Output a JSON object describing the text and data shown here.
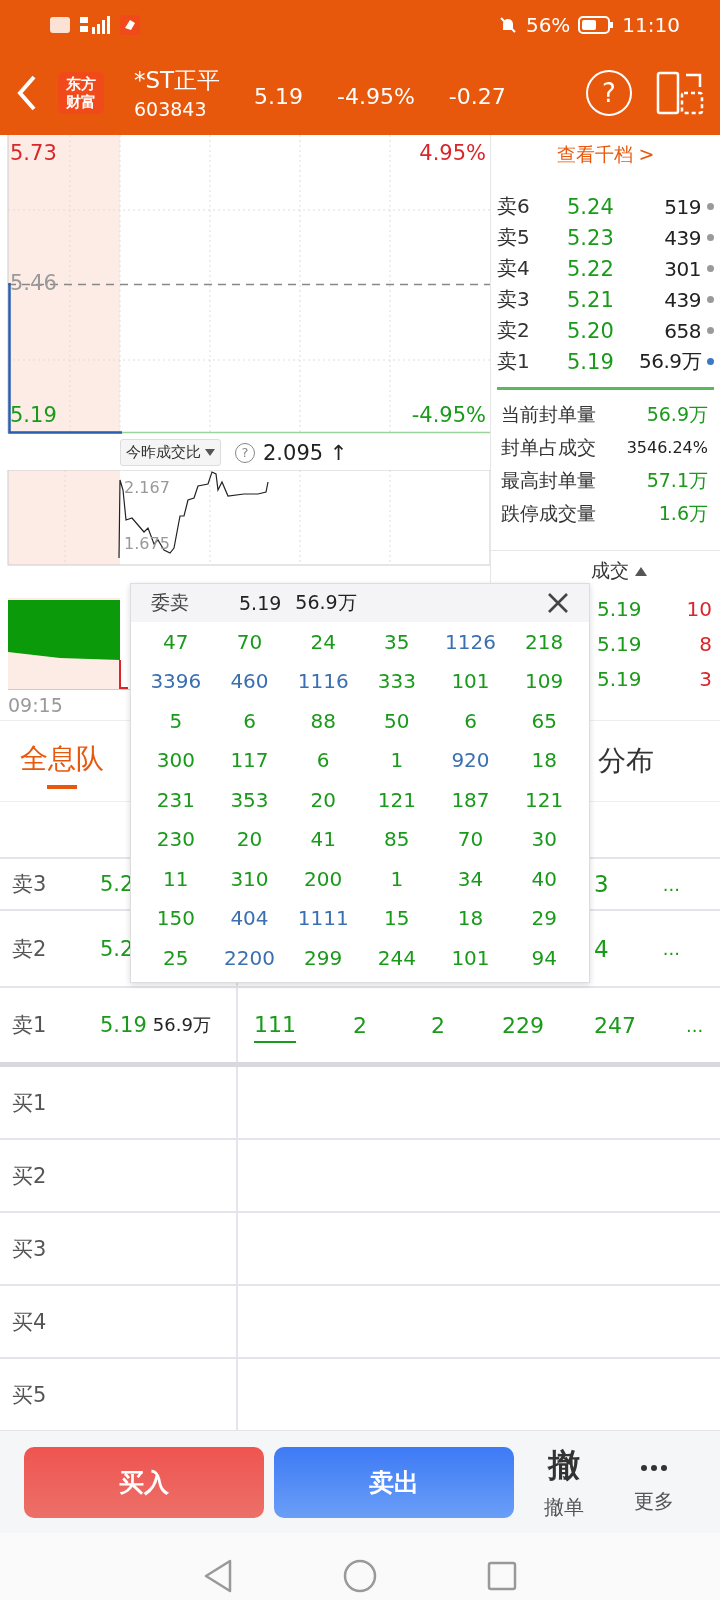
{
  "status_bar": {
    "battery": "56%",
    "time": "11:10"
  },
  "header": {
    "logo": "东方财富",
    "name": "*ST正平",
    "code": "603843",
    "price": "5.19",
    "change_pct": "-4.95%",
    "change": "-0.27",
    "help": "?"
  },
  "price_chart": {
    "high": "5.73",
    "high_pct": "4.95%",
    "mid": "5.46",
    "low": "5.19",
    "low_pct": "-4.95%"
  },
  "ratio": {
    "selector": "今昨成交比",
    "help": "?",
    "value": "2.095",
    "arrow": "↑",
    "high": "2.167",
    "low": "1.675"
  },
  "volume_chart": {
    "time_start": "09:15"
  },
  "depth": {
    "link": "查看千档 >",
    "levels": [
      {
        "label": "卖6",
        "price": "5.24",
        "volume": "519",
        "color": "#9a9a9a"
      },
      {
        "label": "卖5",
        "price": "5.23",
        "volume": "439",
        "color": "#9a9a9a"
      },
      {
        "label": "卖4",
        "price": "5.22",
        "volume": "301",
        "color": "#9a9a9a"
      },
      {
        "label": "卖3",
        "price": "5.21",
        "volume": "439",
        "color": "#9a9a9a"
      },
      {
        "label": "卖2",
        "price": "5.20",
        "volume": "658",
        "color": "#9a9a9a"
      },
      {
        "label": "卖1",
        "price": "5.19",
        "volume": "56.9万",
        "color": "#3a78c8"
      }
    ]
  },
  "seal_stats": [
    {
      "label": "当前封单量",
      "value": "56.9万"
    },
    {
      "label": "封单占成交",
      "value": "3546.24%"
    },
    {
      "label": "最高封单量",
      "value": "57.1万"
    },
    {
      "label": "跌停成交量",
      "value": "1.6万"
    }
  ],
  "trades": {
    "header": "成交",
    "rows": [
      {
        "price": "5.19",
        "volume": "10"
      },
      {
        "price": "5.19",
        "volume": "8"
      },
      {
        "price": "5.19",
        "volume": "3"
      }
    ]
  },
  "tabs": [
    {
      "label": "全息队",
      "selected": true
    },
    {
      "label": "分布",
      "selected": false
    }
  ],
  "queue_rows": [
    {
      "label": "卖3",
      "price": "5.2",
      "count": "3",
      "more": "..."
    },
    {
      "label": "卖2",
      "price": "5.2",
      "count": "4",
      "more": "..."
    },
    {
      "label": "卖1",
      "price": "5.19",
      "volume": "56.9万",
      "orders": [
        {
          "value": "111",
          "selected": true
        },
        {
          "value": "2",
          "selected": false
        },
        {
          "value": "2",
          "selected": false
        },
        {
          "value": "229",
          "selected": false
        },
        {
          "value": "247",
          "selected": false
        }
      ],
      "more": "..."
    },
    {
      "label": "买1"
    },
    {
      "label": "买2"
    },
    {
      "label": "买3"
    },
    {
      "label": "买4"
    },
    {
      "label": "买5"
    }
  ],
  "popup": {
    "title": "委卖",
    "price": "5.19",
    "volume": "56.9万",
    "rows": [
      [
        {
          "value": "47",
          "color": "#1a9a1a"
        },
        {
          "value": "70",
          "color": "#1a9a1a"
        },
        {
          "value": "24",
          "color": "#1a9a1a"
        },
        {
          "value": "35",
          "color": "#1a9a1a"
        },
        {
          "value": "1126",
          "color": "#3a6fb0"
        },
        {
          "value": "218",
          "color": "#1a9a1a"
        }
      ],
      [
        {
          "value": "3396",
          "color": "#3a6fb0"
        },
        {
          "value": "460",
          "color": "#3a6fb0"
        },
        {
          "value": "1116",
          "color": "#3a6fb0"
        },
        {
          "value": "333",
          "color": "#1a9a1a"
        },
        {
          "value": "101",
          "color": "#1a9a1a"
        },
        {
          "value": "109",
          "color": "#1a9a1a"
        }
      ],
      [
        {
          "value": "5",
          "color": "#1a9a1a"
        },
        {
          "value": "6",
          "color": "#1a9a1a"
        },
        {
          "value": "88",
          "color": "#1a9a1a"
        },
        {
          "value": "50",
          "color": "#1a9a1a"
        },
        {
          "value": "6",
          "color": "#1a9a1a"
        },
        {
          "value": "65",
          "color": "#1a9a1a"
        }
      ],
      [
        {
          "value": "300",
          "color": "#1a9a1a"
        },
        {
          "value": "117",
          "color": "#1a9a1a"
        },
        {
          "value": "6",
          "color": "#1a9a1a"
        },
        {
          "value": "1",
          "color": "#1a9a1a"
        },
        {
          "value": "920",
          "color": "#3a6fb0"
        },
        {
          "value": "18",
          "color": "#1a9a1a"
        }
      ],
      [
        {
          "value": "231",
          "color": "#1a9a1a"
        },
        {
          "value": "353",
          "color": "#1a9a1a"
        },
        {
          "value": "20",
          "color": "#1a9a1a"
        },
        {
          "value": "121",
          "color": "#1a9a1a"
        },
        {
          "value": "187",
          "color": "#1a9a1a"
        },
        {
          "value": "121",
          "color": "#1a9a1a"
        }
      ],
      [
        {
          "value": "230",
          "color": "#1a9a1a"
        },
        {
          "value": "20",
          "color": "#1a9a1a"
        },
        {
          "value": "41",
          "color": "#1a9a1a"
        },
        {
          "value": "85",
          "color": "#1a9a1a"
        },
        {
          "value": "70",
          "color": "#1a9a1a"
        },
        {
          "value": "30",
          "color": "#1a9a1a"
        }
      ],
      [
        {
          "value": "11",
          "color": "#1a9a1a"
        },
        {
          "value": "310",
          "color": "#1a9a1a"
        },
        {
          "value": "200",
          "color": "#1a9a1a"
        },
        {
          "value": "1",
          "color": "#1a9a1a"
        },
        {
          "value": "34",
          "color": "#1a9a1a"
        },
        {
          "value": "40",
          "color": "#1a9a1a"
        }
      ],
      [
        {
          "value": "150",
          "color": "#1a9a1a"
        },
        {
          "value": "404",
          "color": "#3a6fb0"
        },
        {
          "value": "1111",
          "color": "#3a6fb0"
        },
        {
          "value": "15",
          "color": "#1a9a1a"
        },
        {
          "value": "18",
          "color": "#1a9a1a"
        },
        {
          "value": "29",
          "color": "#1a9a1a"
        }
      ],
      [
        {
          "value": "25",
          "color": "#1a9a1a"
        },
        {
          "value": "2200",
          "color": "#3a6fb0"
        },
        {
          "value": "299",
          "color": "#1a9a1a"
        },
        {
          "value": "244",
          "color": "#1a9a1a"
        },
        {
          "value": "101",
          "color": "#1a9a1a"
        },
        {
          "value": "94",
          "color": "#1a9a1a"
        }
      ]
    ]
  },
  "actions": {
    "buy": "买入",
    "sell": "卖出",
    "cancel_icon": "撤",
    "cancel": "撤单",
    "more": "更多"
  }
}
